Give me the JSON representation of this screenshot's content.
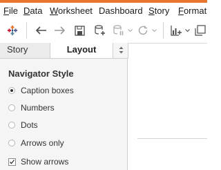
{
  "colors": {
    "accent_bar": "#e8762d",
    "menu_underline": "#1a1a1a",
    "panel_background": "#f5f5f5"
  },
  "menu": {
    "file": "File",
    "data": "Data",
    "worksheet": "Worksheet",
    "dashboard": "Dashboard",
    "story": "Story",
    "format": "Format"
  },
  "toolbar": {
    "icons": [
      "tableau-logo-icon",
      "back-arrow-icon",
      "forward-arrow-icon",
      "save-icon",
      "new-datasource-icon",
      "pause-datasource-icon",
      "refresh-icon",
      "new-worksheet-icon",
      "duplicate-icon"
    ]
  },
  "side_panel": {
    "tabs": {
      "story": "Story",
      "layout": "Layout"
    },
    "tab_menu_icon": "chevron-updown-icon",
    "heading": "Navigator Style",
    "options": [
      {
        "label": "Caption boxes",
        "selected": true
      },
      {
        "label": "Numbers",
        "selected": false
      },
      {
        "label": "Dots",
        "selected": false
      },
      {
        "label": "Arrows only",
        "selected": false
      }
    ],
    "show_arrows": {
      "label": "Show arrows",
      "checked": true
    }
  }
}
